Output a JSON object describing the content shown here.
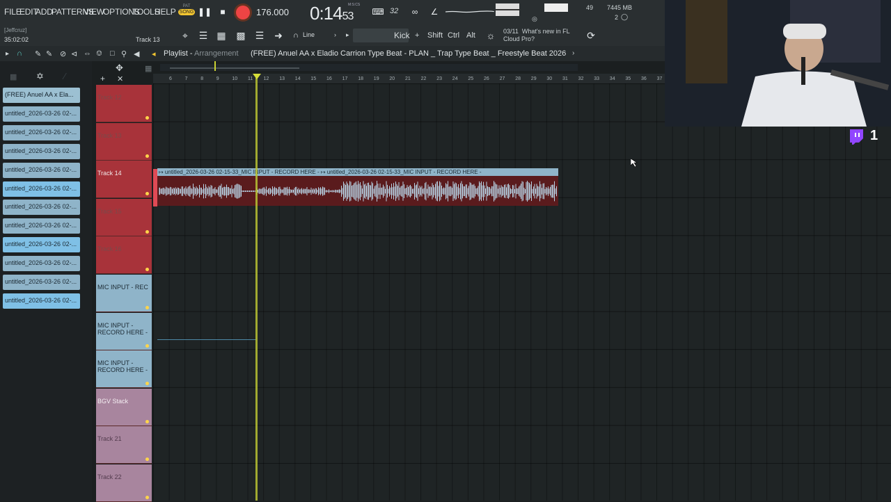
{
  "menu": [
    "FILE",
    "EDIT",
    "ADD",
    "PATTERNS",
    "VIEW",
    "OPTIONS",
    "TOOLS",
    "HELP"
  ],
  "transport": {
    "pat_label": "PAT",
    "song_label": "SONG",
    "tempo": "176.000",
    "time_main": "0:14",
    "time_sub": "53",
    "time_unit": "M:S:CS",
    "cpu_num": "49",
    "memory": "7445 MB",
    "poly": "2",
    "pattern_num": "32",
    "cpu_label": "0"
  },
  "toolbar2": {
    "user": "[Jeffcruz]",
    "clock": "35:02:02",
    "track_label": "Track 13",
    "line_mode": "Line",
    "kick": "Kick",
    "mod_keys": [
      "Shift",
      "Ctrl",
      "Alt"
    ],
    "news_date": "03/11",
    "news_text_1": "What's new in FL",
    "news_text_2": "Cloud Pro?"
  },
  "playlist": {
    "title": "Playlist",
    "subtitle": "Arrangement",
    "project_name": "(FREE) Anuel AA x Eladio Carrion Type Beat - PLAN _ Trap Type Beat _ Freestyle  Beat 2026"
  },
  "browser": [
    "(FREE) Anuel AA x Ela...",
    "untitled_2026-03-26 02-...",
    "untitled_2026-03-26 02-...",
    "untitled_2026-03-26 02-...",
    "untitled_2026-03-26 02-...",
    "untitled_2026-03-26 02-...",
    "untitled_2026-03-26 02-...",
    "untitled_2026-03-26 02-...",
    "untitled_2026-03-26 02-...",
    "untitled_2026-03-26 02-...",
    "untitled_2026-03-26 02-...",
    "untitled_2026-03-26 02-..."
  ],
  "tracks": [
    {
      "label": "Track 12"
    },
    {
      "label": "Track 13"
    },
    {
      "label": "Track 14"
    },
    {
      "label": "Track 15"
    },
    {
      "label": "Track 16"
    },
    {
      "label": "MIC INPUT - REC"
    },
    {
      "label": "MIC INPUT - RECORD HERE -"
    },
    {
      "label": "MIC INPUT - RECORD HERE -"
    },
    {
      "label": "BGV Stack"
    },
    {
      "label": "Track 21"
    },
    {
      "label": "Track 22"
    }
  ],
  "ruler": [
    "6",
    "7",
    "8",
    "9",
    "10",
    "11",
    "12",
    "13",
    "14",
    "15",
    "16",
    "17",
    "18",
    "19",
    "20",
    "21",
    "22",
    "23",
    "24",
    "25",
    "26",
    "27",
    "28",
    "29",
    "30",
    "31",
    "32",
    "33",
    "34",
    "35",
    "36",
    "37"
  ],
  "clip": {
    "title": "↦ untitled_2026-03-26 02-15-33_MIC INPUT - RECORD HERE - ↦ untitled_2026-03-26 02-15-33_MIC INPUT - RECORD HERE -"
  },
  "stream": {
    "viewer_count": "1"
  },
  "colors": {
    "track_red": "#a8333a",
    "track_blue": "#8fb4c9",
    "track_pink": "#a8859e",
    "playhead": "#b8c232",
    "record": "#e44444"
  }
}
